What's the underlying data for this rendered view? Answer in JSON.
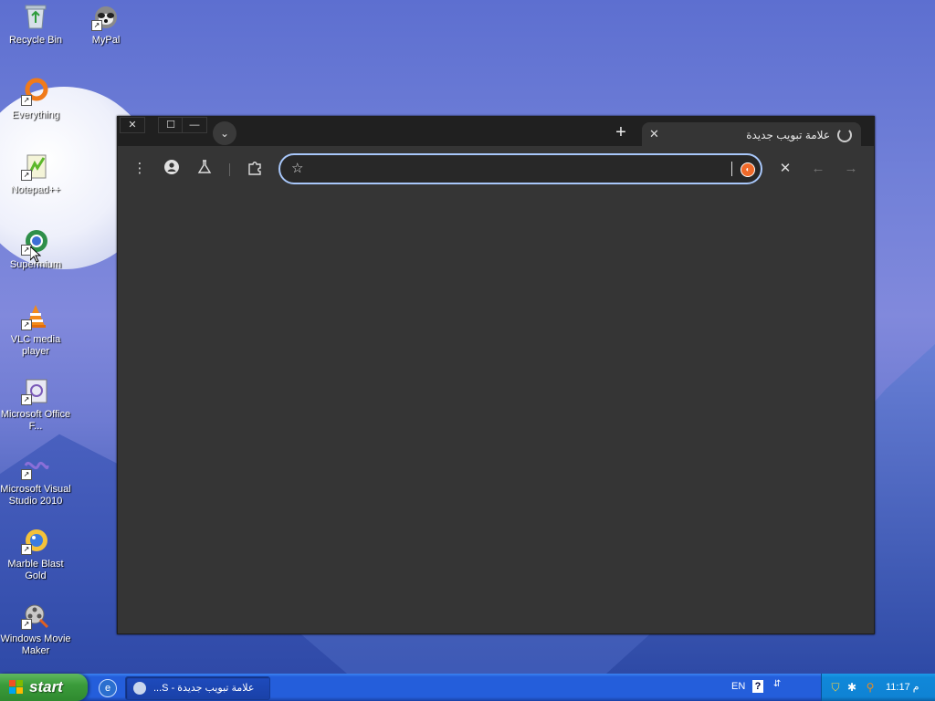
{
  "desktop": {
    "icons": [
      {
        "label": "Recycle Bin",
        "icon": "recycle-bin-icon"
      },
      {
        "label": "MyPal",
        "icon": "mypal-icon"
      },
      {
        "label": "Everything",
        "icon": "everything-icon"
      },
      {
        "label": "Notepad++",
        "icon": "notepad-plus-plus-icon"
      },
      {
        "label": "Supermium",
        "icon": "supermium-icon"
      },
      {
        "label": "VLC media player",
        "icon": "vlc-icon"
      },
      {
        "label": "Microsoft Office F...",
        "icon": "office-icon"
      },
      {
        "label": "Microsoft Visual Studio 2010",
        "icon": "visual-studio-icon"
      },
      {
        "label": "Marble Blast Gold",
        "icon": "marble-blast-icon"
      },
      {
        "label": "Windows Movie Maker",
        "icon": "movie-maker-icon"
      }
    ]
  },
  "browser": {
    "window_buttons": {
      "close": "✕",
      "maximize": "☐",
      "minimize": "—"
    },
    "tab": {
      "title": "علامة تبويب جديدة",
      "close": "✕"
    },
    "new_tab": "+",
    "omnibox": {
      "value": "",
      "placeholder": ""
    },
    "colors": {
      "frame": "#202020",
      "toolbar": "#353535",
      "omnibox_border": "#a8c7fa"
    }
  },
  "taskbar": {
    "start_label": "start",
    "task_button_label": "علامة تبويب جديدة - S...",
    "language": "EN",
    "help": "?",
    "clock": "11:17 م"
  }
}
